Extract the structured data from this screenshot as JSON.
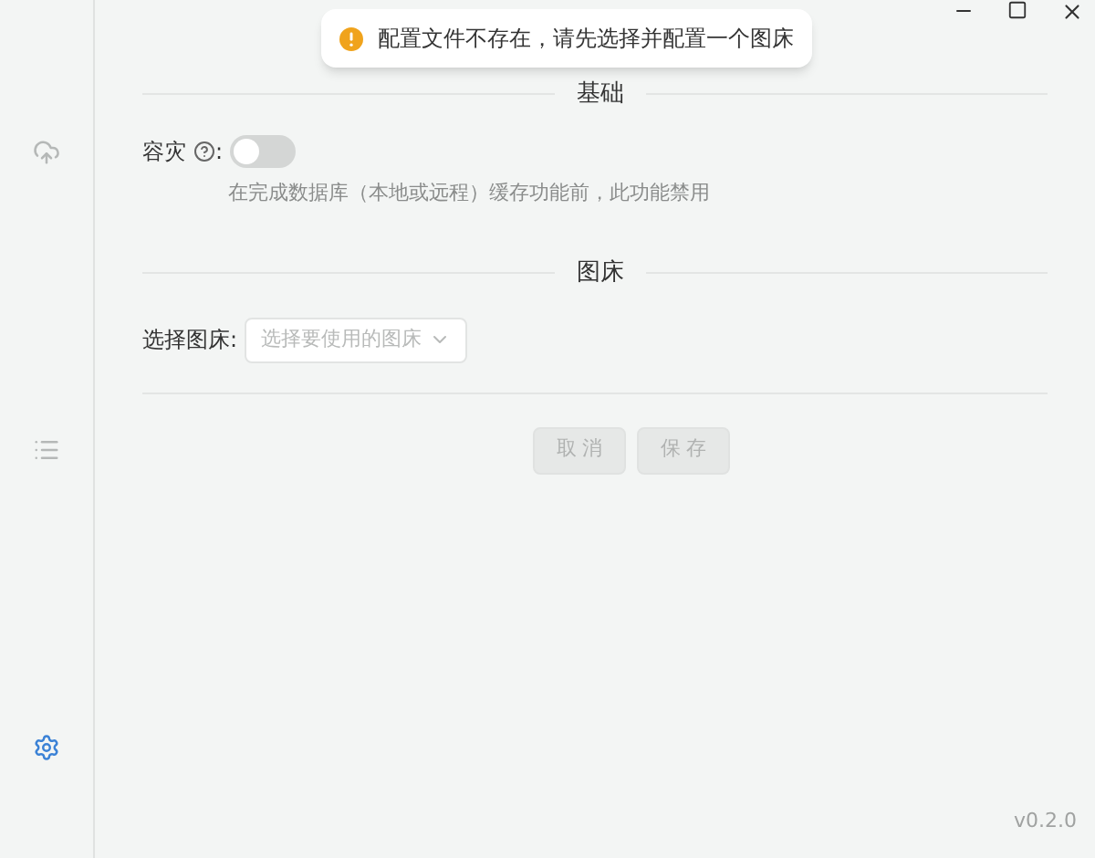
{
  "sidebar": {
    "items": [
      {
        "kind": "upload",
        "selected": false
      },
      {
        "kind": "list",
        "selected": false
      },
      {
        "kind": "settings",
        "selected": true
      }
    ]
  },
  "toast": {
    "kind": "warning",
    "message": "配置文件不存在，请先选择并配置一个图床"
  },
  "basic": {
    "title": "基础",
    "disaster_recovery": {
      "label": "容灾",
      "label_suffix": ":",
      "on": false,
      "hint": "在完成数据库（本地或远程）缓存功能前，此功能禁用"
    }
  },
  "image_host": {
    "title": "图床",
    "label": "选择图床:",
    "placeholder": "选择要使用的图床"
  },
  "buttons": [
    {
      "label": "取 消",
      "disabled": true
    },
    {
      "label": "保 存",
      "disabled": true
    }
  ],
  "version": "v0.2.0"
}
